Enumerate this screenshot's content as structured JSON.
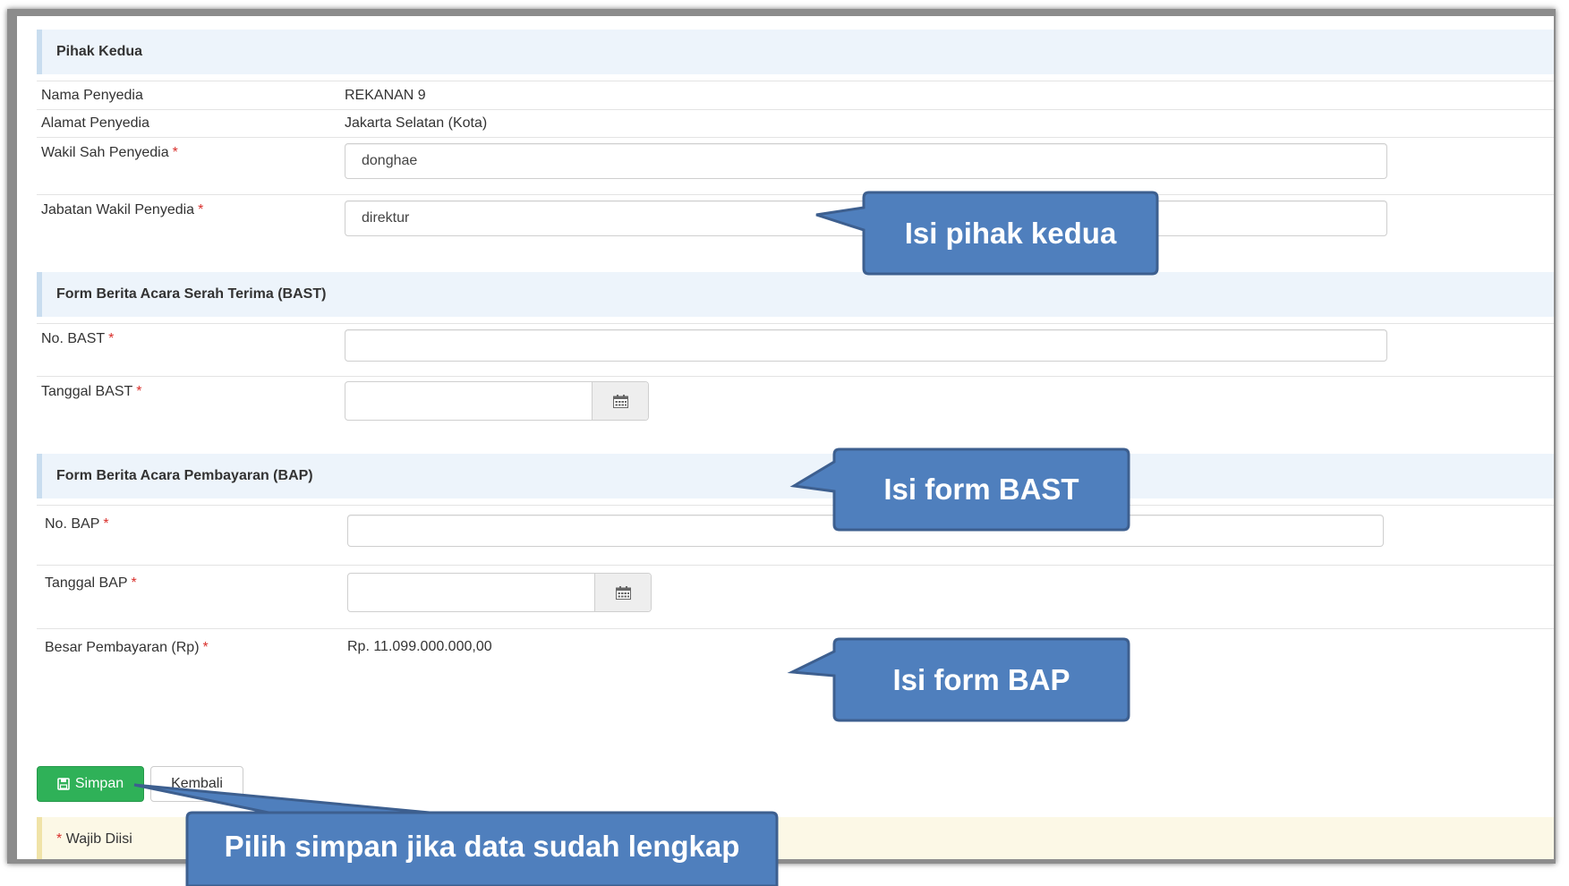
{
  "pihak_kedua": {
    "header": "Pihak Kedua",
    "nama_label": "Nama Penyedia",
    "nama_value": "REKANAN 9",
    "alamat_label": "Alamat Penyedia",
    "alamat_value": "Jakarta Selatan (Kota)",
    "wakil_label": "Wakil Sah Penyedia",
    "wakil_value": "donghae",
    "jabatan_label": "Jabatan Wakil Penyedia",
    "jabatan_value": "direktur"
  },
  "bast": {
    "header": "Form Berita Acara Serah Terima (BAST)",
    "no_label": "No. BAST",
    "no_value": "",
    "tanggal_label": "Tanggal BAST",
    "tanggal_value": ""
  },
  "bap": {
    "header": "Form Berita Acara Pembayaran (BAP)",
    "no_label": "No. BAP",
    "no_value": "",
    "tanggal_label": "Tanggal BAP",
    "tanggal_value": "",
    "besar_label": "Besar Pembayaran (Rp)",
    "besar_value": "Rp. 11.099.000.000,00"
  },
  "required_marker": "*",
  "buttons": {
    "simpan": "Simpan",
    "kembali": "Kembali"
  },
  "note": {
    "star": "*",
    "text": "Wajib Diisi"
  },
  "callouts": {
    "pihak_kedua": "Isi pihak kedua",
    "bast": "Isi form BAST",
    "bap": "Isi form BAP",
    "simpan": "Pilih simpan jika data sudah lengkap"
  },
  "colors": {
    "callout_fill": "#4f7fbd",
    "callout_border": "#3d5f8f",
    "button_green": "#2fb158",
    "section_bg": "#edf4fb",
    "required_red": "#d9302c"
  },
  "icons": {
    "calendar": "calendar-icon",
    "save": "save-icon"
  }
}
